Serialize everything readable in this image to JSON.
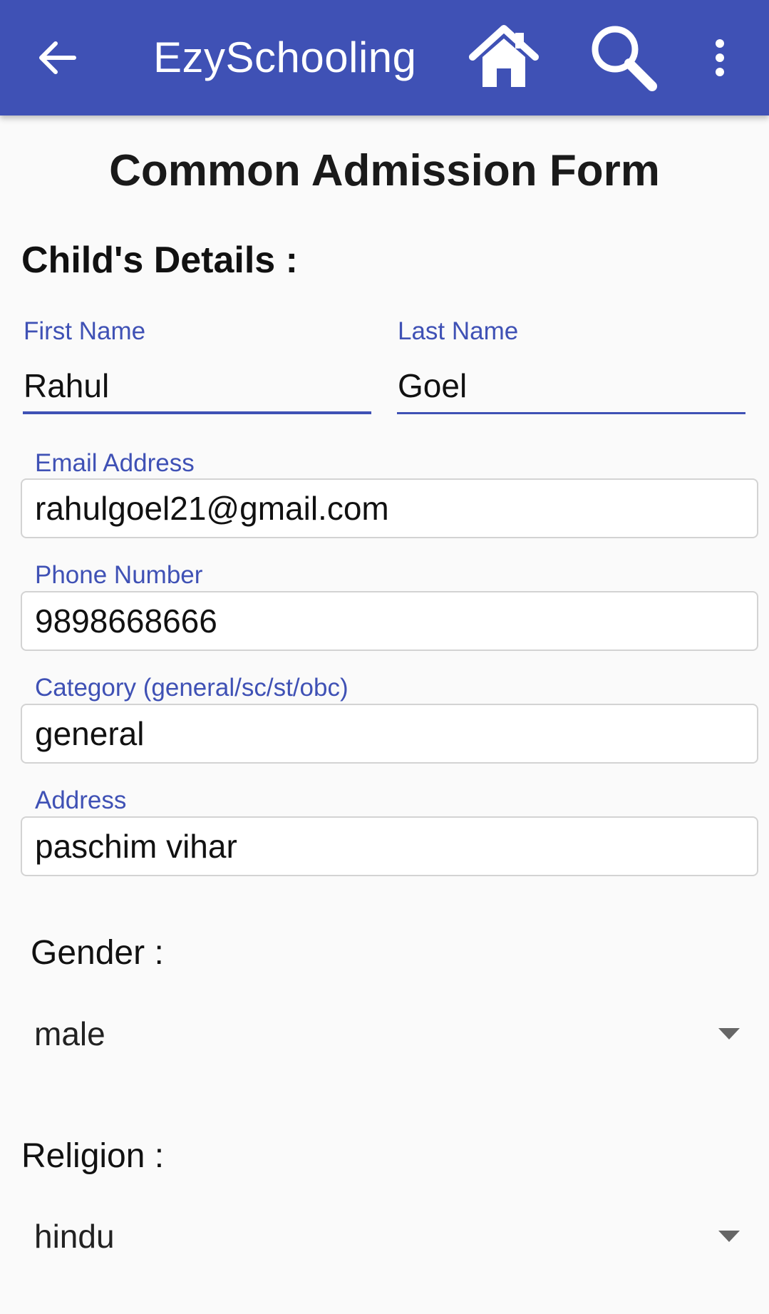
{
  "appbar": {
    "title": "EzySchooling",
    "icons": [
      "back-arrow-icon",
      "home-icon",
      "search-icon",
      "more-vert-icon"
    ],
    "background": "#3f51b5"
  },
  "page": {
    "title": "Common Admission Form",
    "section_title": "Child's Details :"
  },
  "form": {
    "first_name": {
      "label": "First Name",
      "value": "Rahul"
    },
    "last_name": {
      "label": "Last Name",
      "value": "Goel"
    },
    "email": {
      "label": "Email Address",
      "value": "rahulgoel21@gmail.com"
    },
    "phone": {
      "label": "Phone Number",
      "value": "9898668666"
    },
    "category": {
      "label": "Category (general/sc/st/obc)",
      "value": "general"
    },
    "address": {
      "label": "Address",
      "value": "paschim vihar"
    },
    "gender": {
      "label": "Gender :",
      "value": "male"
    },
    "religion": {
      "label": "Religion :",
      "value": "hindu"
    }
  },
  "colors": {
    "accent": "#3f51b5",
    "label": "#3f51b5",
    "background": "#fafafa"
  }
}
